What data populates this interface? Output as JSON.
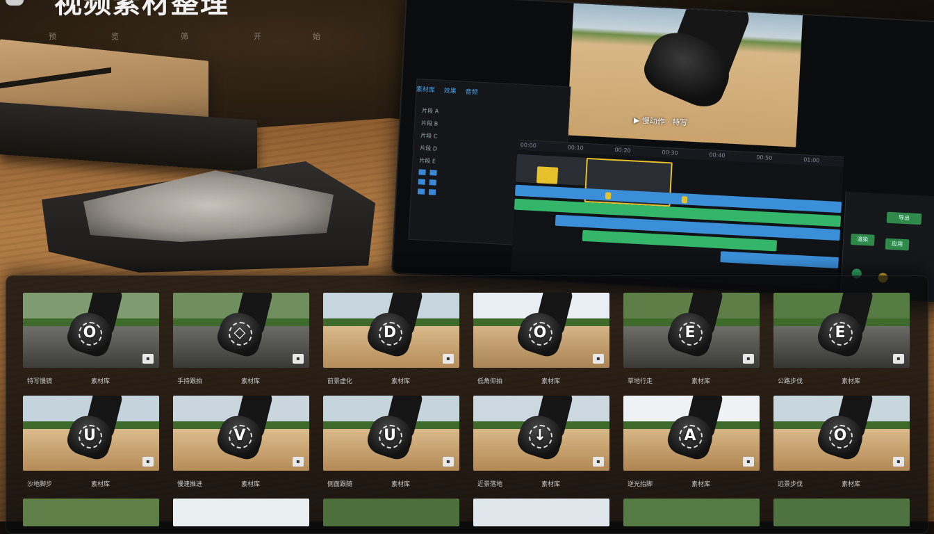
{
  "header": {
    "title": "视频素材整理",
    "subnav": [
      "预",
      "览",
      "筛",
      "开",
      "始"
    ]
  },
  "editor": {
    "panel_tabs": [
      "素材库",
      "效果",
      "音频"
    ],
    "bins": [
      "片段 A",
      "片段 B",
      "片段 C",
      "片段 D",
      "片段 E"
    ],
    "ruler": [
      "00:00",
      "00:10",
      "00:20",
      "00:30",
      "00:40",
      "00:50",
      "01:00"
    ],
    "preview_subtitle": "▶ 慢动作 · 特写",
    "inspector_buttons": [
      "导出",
      "渲染",
      "应用"
    ]
  },
  "gallery": {
    "rows": [
      [
        {
          "glyph": "O",
          "badge": "▪",
          "label": "特写慢镜",
          "tag": "素材库"
        },
        {
          "glyph": "◇",
          "badge": "▪",
          "label": "手持跟拍",
          "tag": "素材库"
        },
        {
          "glyph": "D",
          "badge": "▪",
          "label": "前景虚化",
          "tag": "素材库"
        },
        {
          "glyph": "O",
          "badge": "▪",
          "label": "低角仰拍",
          "tag": "素材库"
        },
        {
          "glyph": "E",
          "badge": "▪",
          "label": "草地行走",
          "tag": "素材库"
        },
        {
          "glyph": "E",
          "badge": "▪",
          "label": "公路步伐",
          "tag": "素材库"
        }
      ],
      [
        {
          "glyph": "U",
          "badge": "▪",
          "label": "沙地脚步",
          "tag": "素材库"
        },
        {
          "glyph": "V",
          "badge": "▪",
          "label": "慢速推进",
          "tag": "素材库"
        },
        {
          "glyph": "U",
          "badge": "▪",
          "label": "侧面跟随",
          "tag": "素材库"
        },
        {
          "glyph": "↓",
          "badge": "▪",
          "label": "近景落地",
          "tag": "素材库"
        },
        {
          "glyph": "A",
          "badge": "▪",
          "label": "逆光抬脚",
          "tag": "素材库"
        },
        {
          "glyph": "O",
          "badge": "▪",
          "label": "远景步伐",
          "tag": "素材库"
        }
      ]
    ]
  },
  "colors": {
    "accent_blue": "#3b8fd9",
    "accent_green": "#33b56a",
    "accent_yellow": "#e7c12c"
  }
}
